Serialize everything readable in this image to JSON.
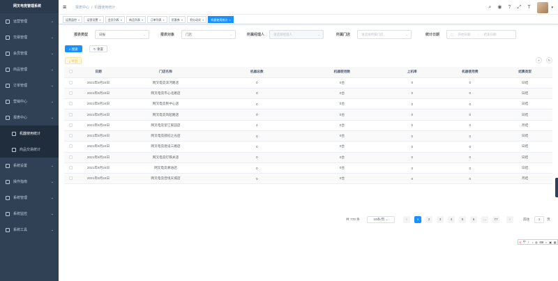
{
  "app": {
    "title": "网叉电竞管理系统"
  },
  "sidebar": {
    "items": [
      {
        "label": "运营管理",
        "icon": "dashboard-icon"
      },
      {
        "label": "交易管理",
        "icon": "trade-icon"
      },
      {
        "label": "会员管理",
        "icon": "member-icon"
      },
      {
        "label": "商品管理",
        "icon": "goods-icon"
      },
      {
        "label": "订单管理",
        "icon": "order-icon"
      },
      {
        "label": "营销中心",
        "icon": "marketing-icon"
      },
      {
        "label": "报表中心",
        "icon": "report-icon"
      }
    ],
    "sub_items": [
      {
        "label": "机器使用统计",
        "icon": "machine-icon"
      },
      {
        "label": "商品交易统计",
        "icon": "goods-stat-icon"
      }
    ],
    "items_after": [
      {
        "label": "系统设置",
        "icon": "settings-icon"
      },
      {
        "label": "操作指南",
        "icon": "guide-icon"
      },
      {
        "label": "系统管理",
        "icon": "system-icon"
      },
      {
        "label": "系统监控",
        "icon": "monitor-icon"
      },
      {
        "label": "系统工具",
        "icon": "tool-icon"
      }
    ]
  },
  "navbar": {
    "breadcrumb": [
      "报表中心",
      "机器使用统计"
    ]
  },
  "tags": [
    "运营监控",
    "运营设置",
    "会员列表",
    "商品列表",
    "订单列表",
    "优惠券",
    "积分动实",
    "机器使用统计"
  ],
  "filters": {
    "report_type_label": "报表类型",
    "report_type_value": "日报",
    "report_object_label": "报表对象",
    "report_object_value": "门店",
    "manager_label": "所属经理人",
    "manager_placeholder": "请选择经理人",
    "store_label": "所属门店",
    "store_placeholder": "请选择所属门店",
    "date_label": "统计日期",
    "date_start_placeholder": "开始日期",
    "date_sep": "-",
    "date_end_placeholder": "结束日期",
    "search_label": "搜索",
    "reset_label": "重置",
    "export_label": "导出"
  },
  "table": {
    "headers": [
      "日期",
      "门店名称",
      "机器总数",
      "机器使用数",
      "上机率",
      "机器使用费",
      "结算类型"
    ],
    "rows": [
      [
        "2021年8月24日",
        "网叉电竞滨河路店",
        "0",
        "0台",
        "0",
        "0",
        "日结"
      ],
      [
        "2021年8月24日",
        "网叉电竞市心北路店",
        "0",
        "0台",
        "0",
        "0",
        "日结"
      ],
      [
        "2021年8月24日",
        "网叉电竞民中心店",
        "0",
        "0台",
        "0",
        "0",
        "日结"
      ],
      [
        "2021年8月24日",
        "网叉电竞凤起路店",
        "0",
        "0台",
        "0",
        "0",
        "日结"
      ],
      [
        "2021年8月24日",
        "网叉电竞望江家园店",
        "4",
        "0台",
        "0",
        "0",
        "月结"
      ],
      [
        "2021年8月24日",
        "网叉电竞部纪之光店",
        "0",
        "0台",
        "0",
        "0",
        "日结"
      ],
      [
        "2021年8月24日",
        "网叉电竞建设三路店",
        "0",
        "0台",
        "0",
        "0",
        "日结"
      ],
      [
        "2021年8月24日",
        "网叉电竞打铁关店",
        "0",
        "0台",
        "0",
        "0",
        "日结"
      ],
      [
        "2021年8月24日",
        "网叉电竞慕语店",
        "0",
        "0台",
        "0",
        "0",
        "日结"
      ],
      [
        "2021年8月24日",
        "网叉电竞佳境天城店",
        "0",
        "0台",
        "0",
        "0",
        "月结"
      ]
    ]
  },
  "pagination": {
    "total": "共 770 条",
    "page_size": "10条/页",
    "pages": [
      "1",
      "2",
      "3",
      "4",
      "5",
      "6",
      "...",
      "77"
    ],
    "goto_label": "前往",
    "goto_value": "1",
    "page_suffix": "页"
  }
}
